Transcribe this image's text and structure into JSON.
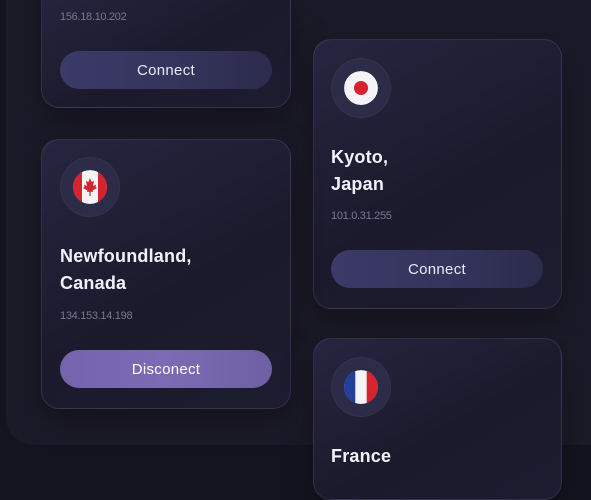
{
  "cards": [
    {
      "ip": "156.18.10.202",
      "button_label": "Connect"
    },
    {
      "city": "Kyoto,",
      "country": "Japan",
      "ip": "101.0.31.255",
      "button_label": "Connect",
      "flag_icon": "japan-flag-icon"
    },
    {
      "city": "Newfoundland,",
      "country": "Canada",
      "ip": "134.153.14.198",
      "button_label": "Disconect",
      "flag_icon": "canada-flag-icon"
    },
    {
      "city": "France",
      "flag_icon": "france-flag-icon"
    }
  ],
  "colors": {
    "background": "#141420",
    "card": "#222137",
    "connect_button": "#3a3966",
    "disconnect_button": "#7867b0",
    "ip_text": "#7a7890"
  }
}
